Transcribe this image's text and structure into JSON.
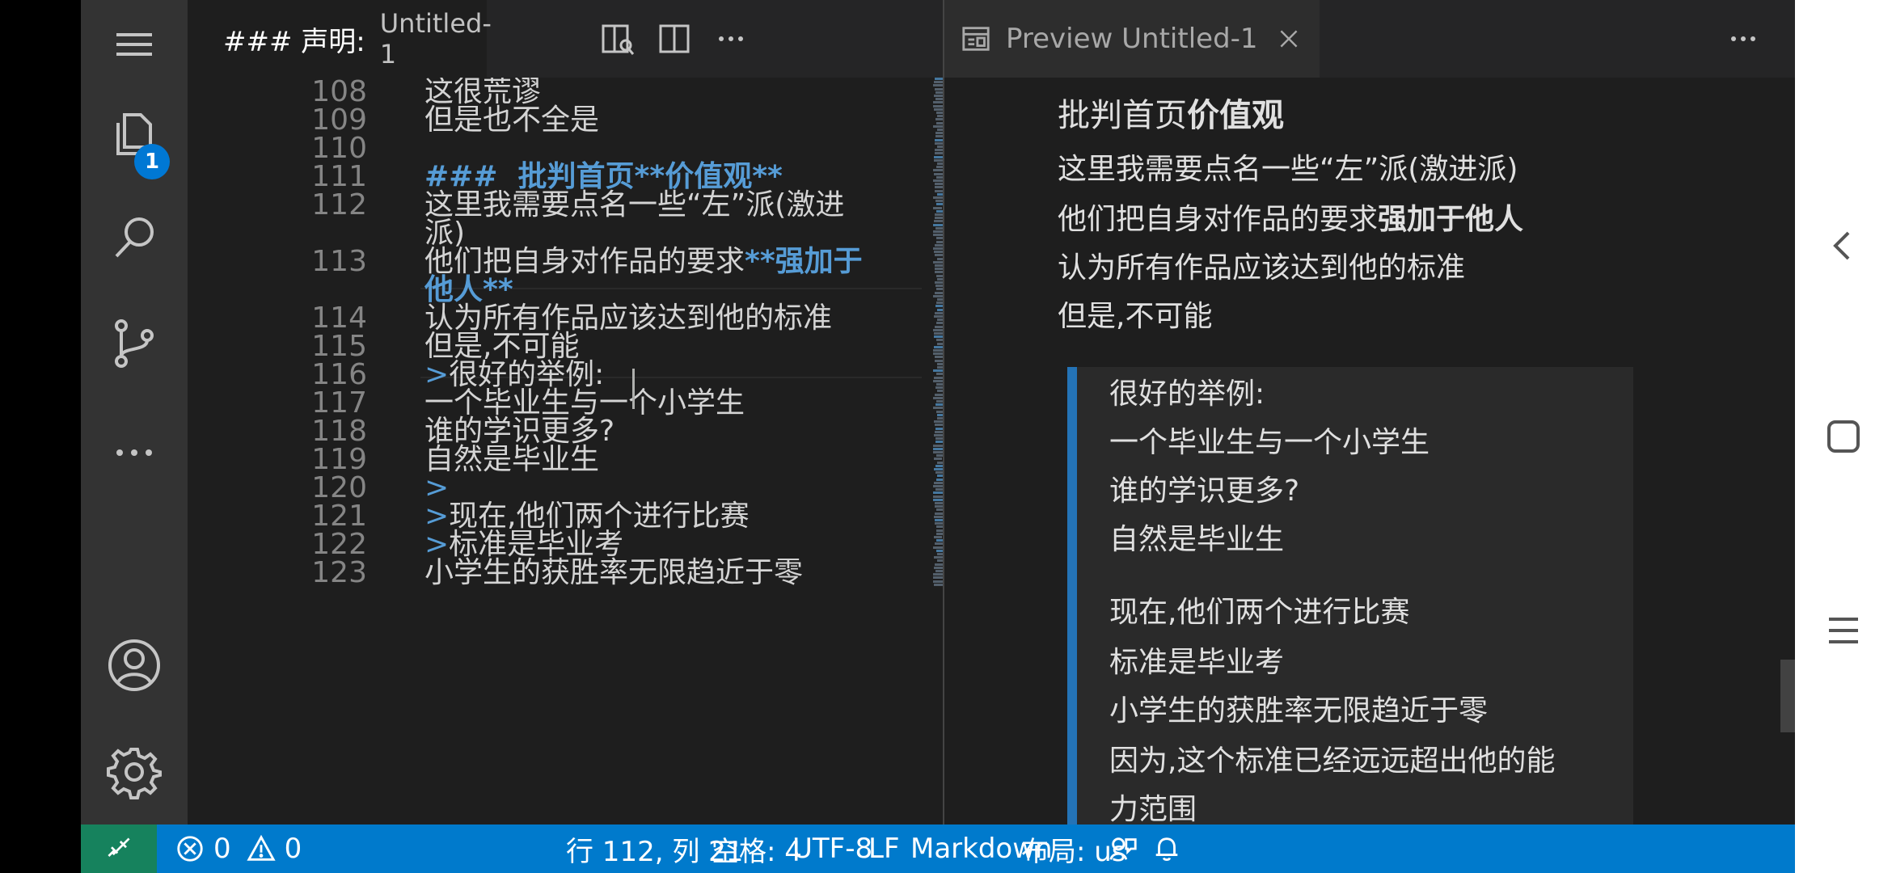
{
  "editor": {
    "tab_title": "### 声明:",
    "tab_description": "Untitled-1",
    "lines": [
      {
        "n": "108",
        "text": "这很荒谬"
      },
      {
        "n": "109",
        "text": "但是也不全是"
      },
      {
        "n": "110",
        "text": ""
      },
      {
        "n": "111",
        "text": "###  批判首页**价值观**"
      },
      {
        "n": "112",
        "text_a": "这里我需要点名一些“左”派(激进",
        "text_b": "派)"
      },
      {
        "n": "113",
        "text_a": "他们把自身对作品的要求",
        "bold_a": "**强加于",
        "bold_b": "他人**"
      },
      {
        "n": "114",
        "text": "认为所有作品应该达到他的标准"
      },
      {
        "n": "115",
        "text": "但是,不可能"
      },
      {
        "n": "116",
        "mark": ">",
        "text": "很好的举例:"
      },
      {
        "n": "117",
        "text": "一个毕业生与一个小学生"
      },
      {
        "n": "118",
        "text": "谁的学识更多?"
      },
      {
        "n": "119",
        "text": "自然是毕业生"
      },
      {
        "n": "120",
        "mark": ">",
        "text": ""
      },
      {
        "n": "121",
        "mark": ">",
        "text": "现在,他们两个进行比赛"
      },
      {
        "n": "122",
        "mark": ">",
        "text": "标准是毕业考"
      },
      {
        "n": "123",
        "text": "小学生的获胜率无限趋近于零"
      }
    ]
  },
  "preview": {
    "tab_title": "Preview Untitled-1",
    "heading_plain": "批判首页",
    "heading_bold": "价值观",
    "paragraphs": [
      {
        "text": "这里我需要点名一些“左”派(激进派)"
      },
      {
        "text": "他们把自身对作品的要求",
        "bold": "强加于他人"
      },
      {
        "text": "认为所有作品应该达到他的标准"
      },
      {
        "text": "但是,不可能"
      }
    ],
    "quote_lines": [
      "很好的举例:",
      "一个毕业生与一个小学生",
      "谁的学识更多?",
      "自然是毕业生",
      "现在,他们两个进行比赛",
      "标准是毕业考",
      "小学生的获胜率无限趋近于零",
      "因为,这个标准已经远远超出他的能",
      "力范围"
    ]
  },
  "activity": {
    "explorer_badge": "1"
  },
  "statusbar": {
    "errors": "0",
    "warnings": "0",
    "position": "行 112, 列 21",
    "indent": "空格: 4",
    "encoding": "UTF-8",
    "eol": "LF",
    "language": "Markdown",
    "layout": "布局: us"
  },
  "colors": {
    "accent": "#007acc",
    "remote": "#16825d",
    "heading": "#569cd6",
    "quote_border": "#2473b6"
  }
}
